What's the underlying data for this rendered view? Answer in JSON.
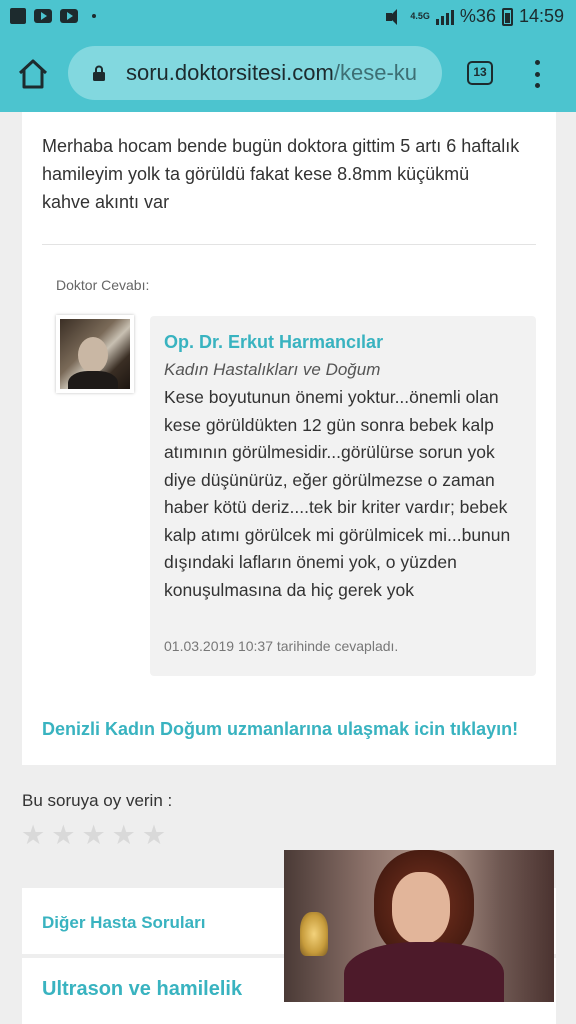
{
  "status_bar": {
    "network": "4.5G",
    "battery": "%36",
    "time": "14:59"
  },
  "browser": {
    "url_domain": "soru.doktorsitesi.com",
    "url_path": "/kese-ku",
    "tab_count": "13"
  },
  "question": {
    "text": "Merhaba hocam bende bugün doktora gittim 5 artı 6 haftalık hamileyim yolk ta görüldü fakat kese 8.8mm küçükmü kahve akıntı var"
  },
  "answer": {
    "label": "Doktor Cevabı:",
    "doctor_name": "Op. Dr. Erkut Harmancılar",
    "specialty": "Kadın Hastalıkları ve Doğum",
    "text": "Kese boyutunun önemi yoktur...önemli olan kese görüldükten 12 gün sonra bebek kalp atımının görülmesidir...görülürse sorun yok diye düşünürüz, eğer görülmezse o zaman haber kötü deriz....tek bir kriter vardır; bebek kalp atımı görülcek mi görülmicek mi...bunun dışındaki lafların önemi yok, o yüzden konuşulmasına da hiç gerek yok",
    "date": "01.03.2019 10:37 tarihinde cevapladı."
  },
  "cta": {
    "link": "Denizli Kadın Doğum uzmanlarına ulaşmak icin tıklayın!"
  },
  "rating": {
    "label": "Bu soruya oy verin :",
    "stars": [
      "★",
      "★",
      "★",
      "★",
      "★"
    ],
    "value": 0
  },
  "other_questions": {
    "title": "Diğer Hasta Soruları",
    "first_title": "Ultrason ve hamilelik"
  },
  "colors": {
    "accent": "#4cc4cf",
    "link": "#39b3c0"
  }
}
